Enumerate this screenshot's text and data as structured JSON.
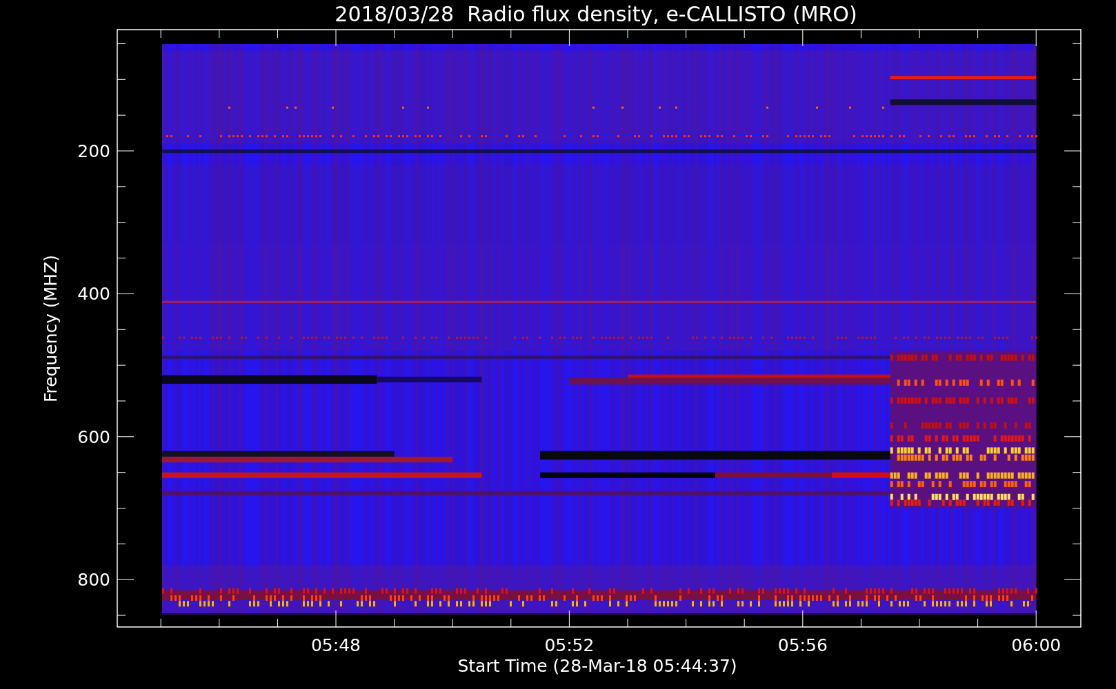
{
  "plot": {
    "title": "2018/03/28  Radio flux density, e-CALLISTO (MRO)",
    "ylabel": "Frequency (MHZ)",
    "xlabel": "Start Time (28-Mar-18 05:44:37)",
    "yticks": [
      "200",
      "400",
      "600",
      "800"
    ],
    "xticks": [
      "05:48",
      "05:52",
      "05:56",
      "06:00"
    ]
  }
}
